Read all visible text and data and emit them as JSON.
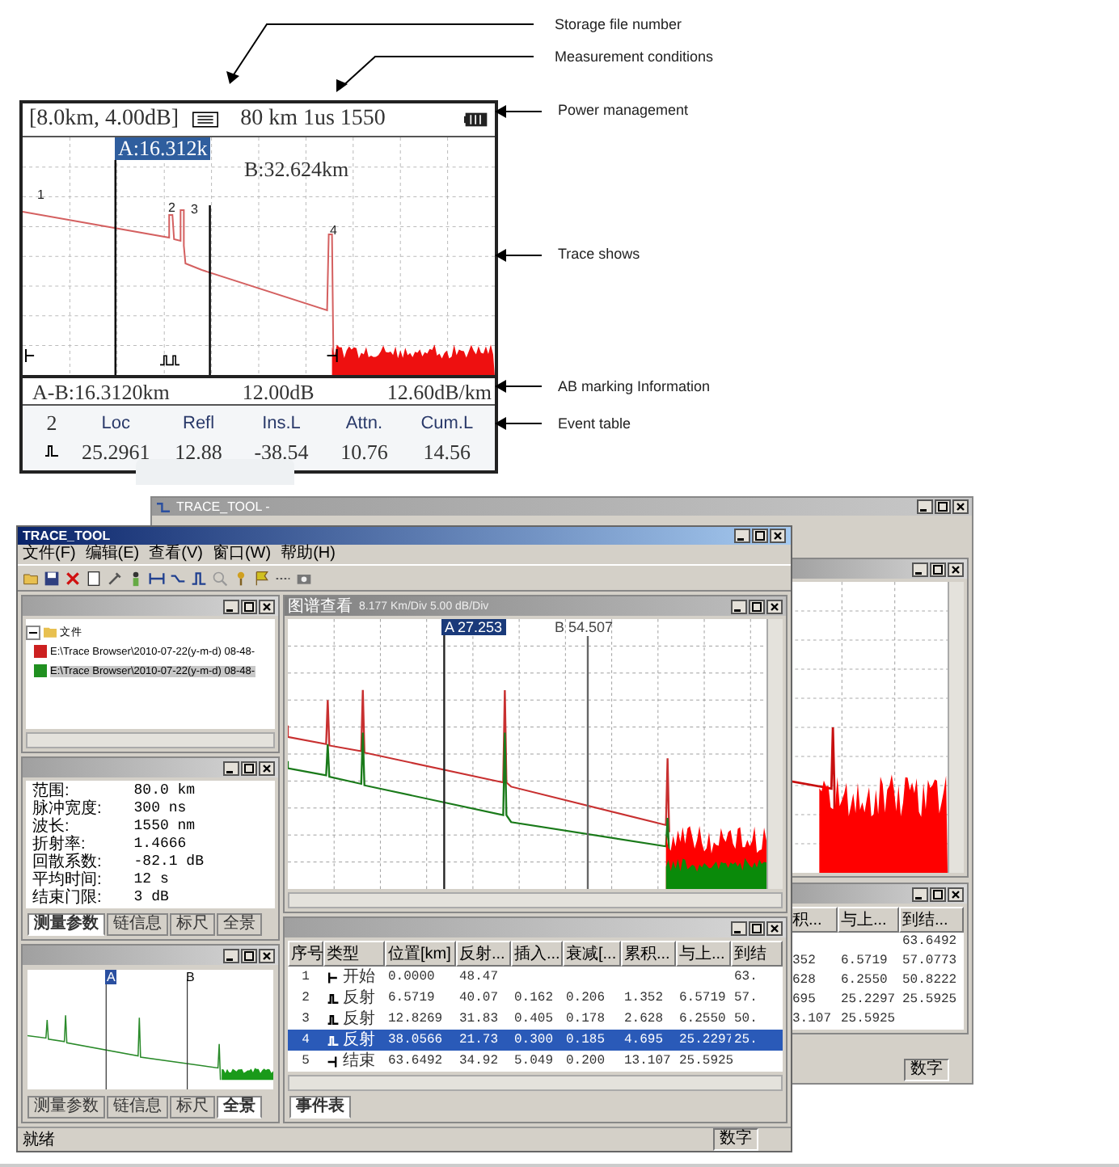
{
  "annotations": [
    {
      "kind": "diagonal",
      "label": "Storage file number"
    },
    {
      "kind": "diagonal",
      "label": "Measurement conditions"
    },
    {
      "kind": "straight",
      "label": "Power management"
    },
    {
      "kind": "straight",
      "label": "Trace shows"
    },
    {
      "kind": "straight",
      "label": "AB marking Information"
    },
    {
      "kind": "straight",
      "label": "Event table"
    }
  ],
  "device_screen": {
    "range_info": "[8.0km, 4.00dB]",
    "conditions": "80 km 1us 1550",
    "marker_a": "A:16.312k",
    "marker_b": "B:32.624km",
    "event_numbers": [
      "1",
      "2",
      "3",
      "4"
    ],
    "ab_info": {
      "distance": "A-B:16.3120km",
      "loss": "12.00dB",
      "attenuation": "12.60dB/km"
    },
    "event_table": {
      "index": "2",
      "columns": [
        "Loc",
        "Refl",
        "Ins.L",
        "Attn.",
        "Cum.L"
      ],
      "values": [
        "25.2961",
        "12.88",
        "-38.54",
        "10.76",
        "14.56"
      ]
    }
  },
  "back_window": {
    "title": "TRACE_TOOL -",
    "table": {
      "columns": [
        "积...",
        "与上...",
        "到结..."
      ],
      "rows": [
        [
          "",
          "",
          "63.6492"
        ],
        [
          "352",
          "6.5719",
          "57.0773"
        ],
        [
          "628",
          "6.2550",
          "50.8222"
        ],
        [
          "695",
          "25.2297",
          "25.5925"
        ],
        [
          "3.107",
          "25.5925",
          ""
        ]
      ]
    },
    "status": "数字"
  },
  "main_window": {
    "title": "TRACE_TOOL",
    "menu": [
      "文件(F)",
      "编辑(E)",
      "查看(V)",
      "窗口(W)",
      "帮助(H)"
    ],
    "file_tree": {
      "root": "文件",
      "files": [
        {
          "path": "E:\\Trace Browser\\2010-07-22(y-m-d) 08-48-",
          "selected": false,
          "color": "#cc2020"
        },
        {
          "path": "E:\\Trace Browser\\2010-07-22(y-m-d) 08-48-",
          "selected": true,
          "color": "#209020"
        }
      ]
    },
    "parameters": {
      "rows": [
        {
          "label": "范围:",
          "value": "80.0 km"
        },
        {
          "label": "脉冲宽度:",
          "value": "300 ns"
        },
        {
          "label": "波长:",
          "value": "1550 nm"
        },
        {
          "label": "折射率:",
          "value": "1.4666"
        },
        {
          "label": "回散系数:",
          "value": "-82.1 dB"
        },
        {
          "label": "平均时间:",
          "value": "12 s"
        },
        {
          "label": "结束门限:",
          "value": "3 dB"
        }
      ]
    },
    "info_tabs": [
      {
        "label": "测量参数",
        "selected": true
      },
      {
        "label": "链信息",
        "selected": false
      },
      {
        "label": "标尺",
        "selected": false
      },
      {
        "label": "全景",
        "selected": false
      }
    ],
    "overview": {
      "marker_a": "A",
      "marker_b": "B"
    },
    "overview_tabs": [
      {
        "label": "测量参数",
        "selected": false
      },
      {
        "label": "链信息",
        "selected": false
      },
      {
        "label": "标尺",
        "selected": false
      },
      {
        "label": "全景",
        "selected": true
      }
    ],
    "trace_view": {
      "title": "图谱查看",
      "scale": "8.177 Km/Div  5.00 dB/Div",
      "marker_a": "A 27.253",
      "marker_b": "B 54.507"
    },
    "event_table": {
      "columns": [
        "序号",
        "类型",
        "位置[km]",
        "反射...",
        "插入...",
        "衰减[...",
        "累积...",
        "与上...",
        "到结"
      ],
      "rows": [
        {
          "kind": "start",
          "selected": false,
          "cells": [
            "1",
            "开始",
            "0.0000",
            "48.47",
            "",
            "",
            "",
            "",
            "63."
          ]
        },
        {
          "kind": "reflect",
          "selected": false,
          "cells": [
            "2",
            "反射",
            "6.5719",
            "40.07",
            "0.162",
            "0.206",
            "1.352",
            "6.5719",
            "57."
          ]
        },
        {
          "kind": "reflect",
          "selected": false,
          "cells": [
            "3",
            "反射",
            "12.8269",
            "31.83",
            "0.405",
            "0.178",
            "2.628",
            "6.2550",
            "50."
          ]
        },
        {
          "kind": "reflect",
          "selected": true,
          "cells": [
            "4",
            "反射",
            "38.0566",
            "21.73",
            "0.300",
            "0.185",
            "4.695",
            "25.2297",
            "25."
          ]
        },
        {
          "kind": "end",
          "selected": false,
          "cells": [
            "5",
            "结束",
            "63.6492",
            "34.92",
            "5.049",
            "0.200",
            "13.107",
            "25.5925",
            ""
          ]
        }
      ]
    },
    "event_tabs": [
      {
        "label": "事件表",
        "selected": true
      }
    ],
    "status_bar": {
      "text": "就绪",
      "indicator": "数字"
    }
  }
}
